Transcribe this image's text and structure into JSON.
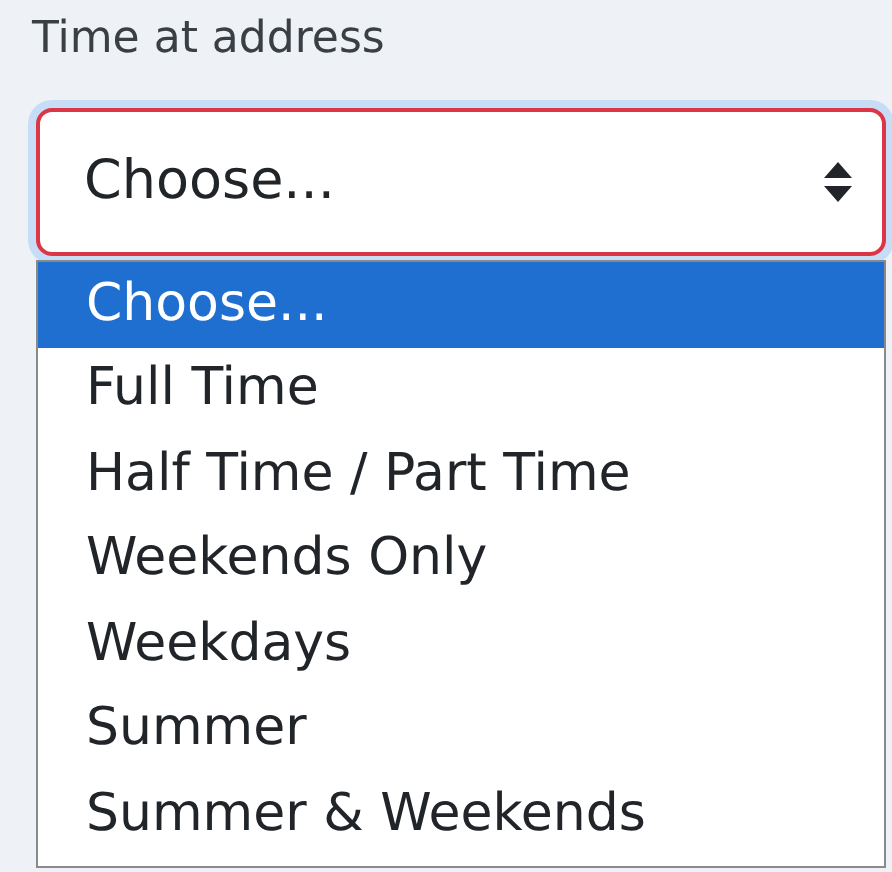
{
  "field": {
    "label": "Time at address",
    "value": "Choose...",
    "invalid": true,
    "expanded": true,
    "options": [
      {
        "label": "Choose...",
        "selected": true
      },
      {
        "label": "Full Time",
        "selected": false
      },
      {
        "label": "Half Time / Part Time",
        "selected": false
      },
      {
        "label": "Weekends Only",
        "selected": false
      },
      {
        "label": "Weekdays",
        "selected": false
      },
      {
        "label": "Summer",
        "selected": false
      },
      {
        "label": "Summer & Weekends",
        "selected": false
      }
    ]
  }
}
